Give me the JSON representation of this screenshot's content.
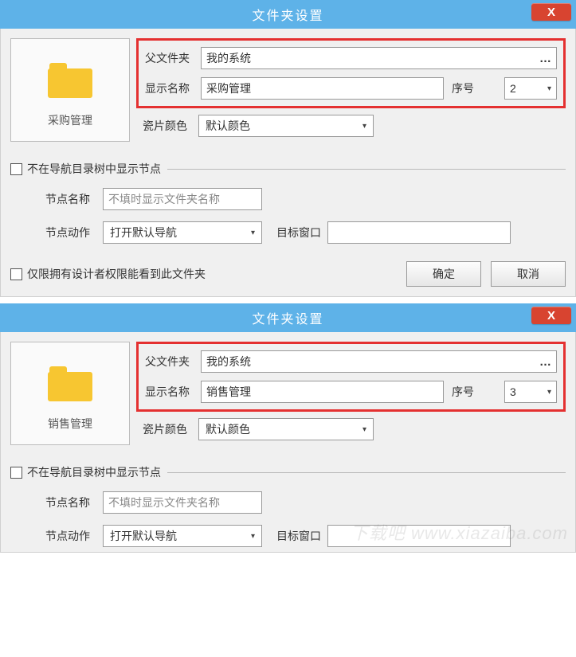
{
  "common": {
    "title": "文件夹设置",
    "close": "X",
    "parent_folder_label": "父文件夹",
    "display_name_label": "显示名称",
    "seq_label": "序号",
    "tile_color_label": "瓷片颜色",
    "tile_color_value": "默认颜色",
    "hide_node_label": "不在导航目录树中显示节点",
    "node_name_label": "节点名称",
    "node_name_placeholder": "不填时显示文件夹名称",
    "node_action_label": "节点动作",
    "node_action_value": "打开默认导航",
    "target_window_label": "目标窗口",
    "designer_only_label": "仅限拥有设计者权限能看到此文件夹",
    "ok_button": "确定",
    "cancel_button": "取消",
    "ellipsis": "…"
  },
  "dialogs": [
    {
      "folder_label": "采购管理",
      "parent_folder": "我的系统",
      "display_name": "采购管理",
      "seq": "2",
      "show_bottom": true
    },
    {
      "folder_label": "销售管理",
      "parent_folder": "我的系统",
      "display_name": "销售管理",
      "seq": "3",
      "show_bottom": false
    }
  ],
  "watermark": "下载吧 www.xiazaiba.com"
}
